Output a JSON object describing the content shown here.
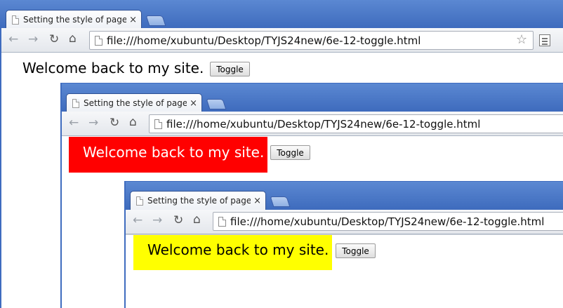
{
  "browser": {
    "tab_title": "Setting the style of page",
    "tab_close": "×",
    "url": "file:///home/xubuntu/Desktop/TYJS24new/6e-12-toggle.html",
    "icons": {
      "back": "back-arrow-icon",
      "forward": "forward-arrow-icon",
      "reload": "reload-icon",
      "home": "home-icon",
      "page": "page-icon",
      "star": "star-icon",
      "menu": "menu-icon"
    }
  },
  "page": {
    "welcome_text": "Welcome back to my site.",
    "toggle_label": "Toggle"
  },
  "states": [
    {
      "name": "default",
      "background": "#ffffff",
      "text_color": "#000000"
    },
    {
      "name": "toggled-red",
      "background": "#ff0000",
      "text_color": "#ffffff"
    },
    {
      "name": "toggled-yellow",
      "background": "#ffff00",
      "text_color": "#000000"
    }
  ],
  "colors": {
    "titlebar": "#4a78c8",
    "window_border": "#3f6cbf",
    "toolbar": "#eceef2"
  }
}
